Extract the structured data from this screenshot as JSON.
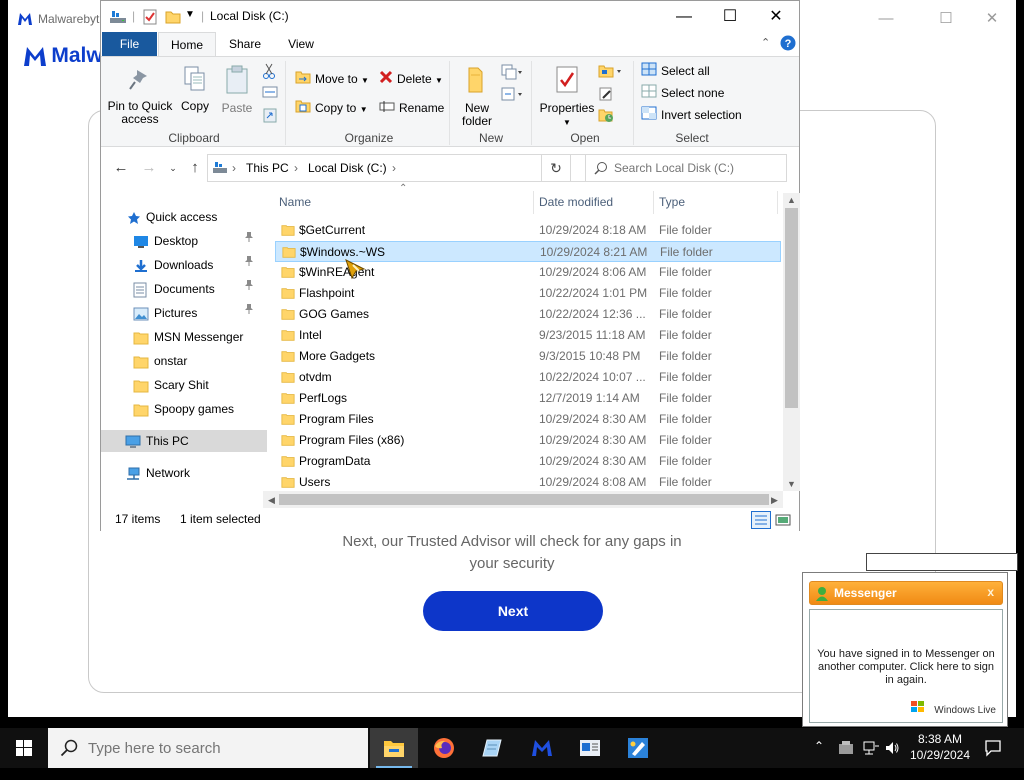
{
  "malwarebytes": {
    "window_title": "Malwarebyt",
    "brand_text": "Malwar",
    "advisor_line1": "Next, our Trusted Advisor will check for any gaps in",
    "advisor_line2": "your security",
    "next_button": "Next",
    "accent_color": "#0d36c9"
  },
  "explorer": {
    "title": "Local Disk (C:)",
    "tabs": {
      "file": "File",
      "home": "Home",
      "share": "Share",
      "view": "View"
    },
    "ribbon": {
      "clipboard": {
        "label": "Clipboard",
        "pin_line1": "Pin to Quick",
        "pin_line2": "access",
        "copy": "Copy",
        "paste": "Paste"
      },
      "organize": {
        "label": "Organize",
        "move_to": "Move to",
        "copy_to": "Copy to",
        "delete": "Delete",
        "rename": "Rename"
      },
      "new": {
        "label": "New",
        "new_folder_line1": "New",
        "new_folder_line2": "folder"
      },
      "open": {
        "label": "Open",
        "properties": "Properties"
      },
      "select": {
        "label": "Select",
        "select_all": "Select all",
        "select_none": "Select none",
        "invert": "Invert selection"
      }
    },
    "address": {
      "this_pc": "This PC",
      "drive": "Local Disk (C:)",
      "search_placeholder": "Search Local Disk (C:)"
    },
    "nav": {
      "quick_access": "Quick access",
      "items": [
        {
          "label": "Desktop",
          "icon": "desktop-icon",
          "pinned": true
        },
        {
          "label": "Downloads",
          "icon": "downloads-icon",
          "pinned": true
        },
        {
          "label": "Documents",
          "icon": "documents-icon",
          "pinned": true
        },
        {
          "label": "Pictures",
          "icon": "pictures-icon",
          "pinned": true
        },
        {
          "label": "MSN Messenger",
          "icon": "folder-icon",
          "pinned": false
        },
        {
          "label": "onstar",
          "icon": "folder-icon",
          "pinned": false
        },
        {
          "label": "Scary Shit",
          "icon": "folder-icon",
          "pinned": false
        },
        {
          "label": "Spoopy games",
          "icon": "folder-icon",
          "pinned": false
        }
      ],
      "this_pc": "This PC",
      "network": "Network"
    },
    "columns": {
      "name": "Name",
      "date": "Date modified",
      "type": "Type"
    },
    "files": [
      {
        "name": "$GetCurrent",
        "date": "10/29/2024 8:18 AM",
        "type": "File folder"
      },
      {
        "name": "$Windows.~WS",
        "date": "10/29/2024 8:21 AM",
        "type": "File folder"
      },
      {
        "name": "$WinREAgent",
        "date": "10/29/2024 8:06 AM",
        "type": "File folder"
      },
      {
        "name": "Flashpoint",
        "date": "10/22/2024 1:01 PM",
        "type": "File folder"
      },
      {
        "name": "GOG Games",
        "date": "10/22/2024 12:36 ...",
        "type": "File folder"
      },
      {
        "name": "Intel",
        "date": "9/23/2015 11:18 AM",
        "type": "File folder"
      },
      {
        "name": "More Gadgets",
        "date": "9/3/2015 10:48 PM",
        "type": "File folder"
      },
      {
        "name": "otvdm",
        "date": "10/22/2024 10:07 ...",
        "type": "File folder"
      },
      {
        "name": "PerfLogs",
        "date": "12/7/2019 1:14 AM",
        "type": "File folder"
      },
      {
        "name": "Program Files",
        "date": "10/29/2024 8:30 AM",
        "type": "File folder"
      },
      {
        "name": "Program Files (x86)",
        "date": "10/29/2024 8:30 AM",
        "type": "File folder"
      },
      {
        "name": "ProgramData",
        "date": "10/29/2024 8:30 AM",
        "type": "File folder"
      },
      {
        "name": "Users",
        "date": "10/29/2024 8:08 AM",
        "type": "File folder"
      }
    ],
    "selected_index": 1,
    "status": {
      "items": "17 items",
      "selected": "1 item selected"
    }
  },
  "messenger": {
    "title": "Messenger",
    "close": "x",
    "message": "You have signed in to Messenger on another computer. Click here to sign in again.",
    "logo_text": "Windows Live"
  },
  "taskbar": {
    "search_placeholder": "Type here to search",
    "apps": [
      "file-explorer-icon",
      "firefox-icon",
      "notepad-icon",
      "malwarebytes-icon",
      "news-icon",
      "paint-icon"
    ],
    "time": "8:38 AM",
    "date": "10/29/2024"
  }
}
